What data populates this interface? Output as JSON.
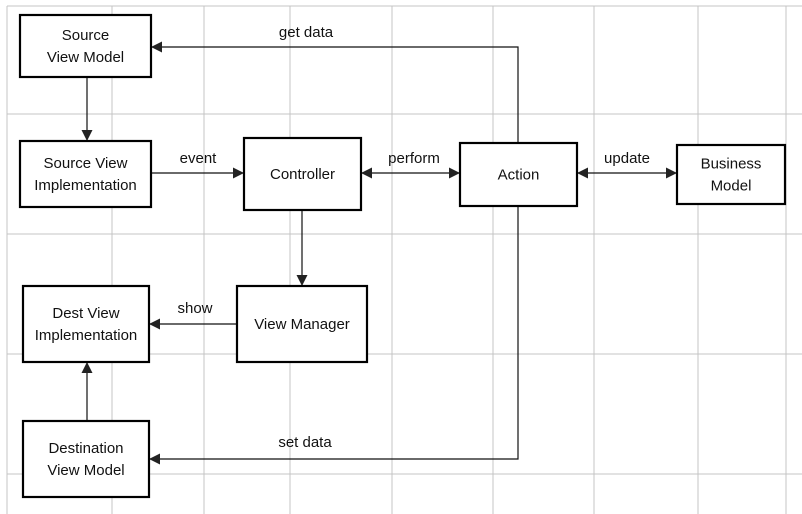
{
  "diagram": {
    "nodes": [
      {
        "id": "source-view-model",
        "lines": [
          "Source",
          "View Model"
        ]
      },
      {
        "id": "source-view-implementation",
        "lines": [
          "Source View",
          "Implementation"
        ]
      },
      {
        "id": "controller",
        "lines": [
          "Controller"
        ]
      },
      {
        "id": "action",
        "lines": [
          "Action"
        ]
      },
      {
        "id": "business-model",
        "lines": [
          "Business",
          "Model"
        ]
      },
      {
        "id": "dest-view-implementation",
        "lines": [
          "Dest View",
          "Implementation"
        ]
      },
      {
        "id": "view-manager",
        "lines": [
          "View Manager"
        ]
      },
      {
        "id": "destination-view-model",
        "lines": [
          "Destination",
          "View Model"
        ]
      }
    ],
    "edges": [
      {
        "id": "get-data",
        "from": "action",
        "to": "source-view-model",
        "label": "get data",
        "direction": "forward"
      },
      {
        "id": "svm-to-svi",
        "from": "source-view-model",
        "to": "source-view-implementation",
        "label": "",
        "direction": "forward"
      },
      {
        "id": "event",
        "from": "source-view-implementation",
        "to": "controller",
        "label": "event",
        "direction": "forward"
      },
      {
        "id": "perform",
        "from": "controller",
        "to": "action",
        "label": "perform",
        "direction": "both"
      },
      {
        "id": "update",
        "from": "action",
        "to": "business-model",
        "label": "update",
        "direction": "both"
      },
      {
        "id": "controller-to-vm",
        "from": "controller",
        "to": "view-manager",
        "label": "",
        "direction": "forward"
      },
      {
        "id": "show",
        "from": "view-manager",
        "to": "dest-view-implementation",
        "label": "show",
        "direction": "forward"
      },
      {
        "id": "dvm-to-dvi",
        "from": "destination-view-model",
        "to": "dest-view-implementation",
        "label": "",
        "direction": "forward"
      },
      {
        "id": "set-data",
        "from": "action",
        "to": "destination-view-model",
        "label": "set data",
        "direction": "forward"
      }
    ]
  }
}
